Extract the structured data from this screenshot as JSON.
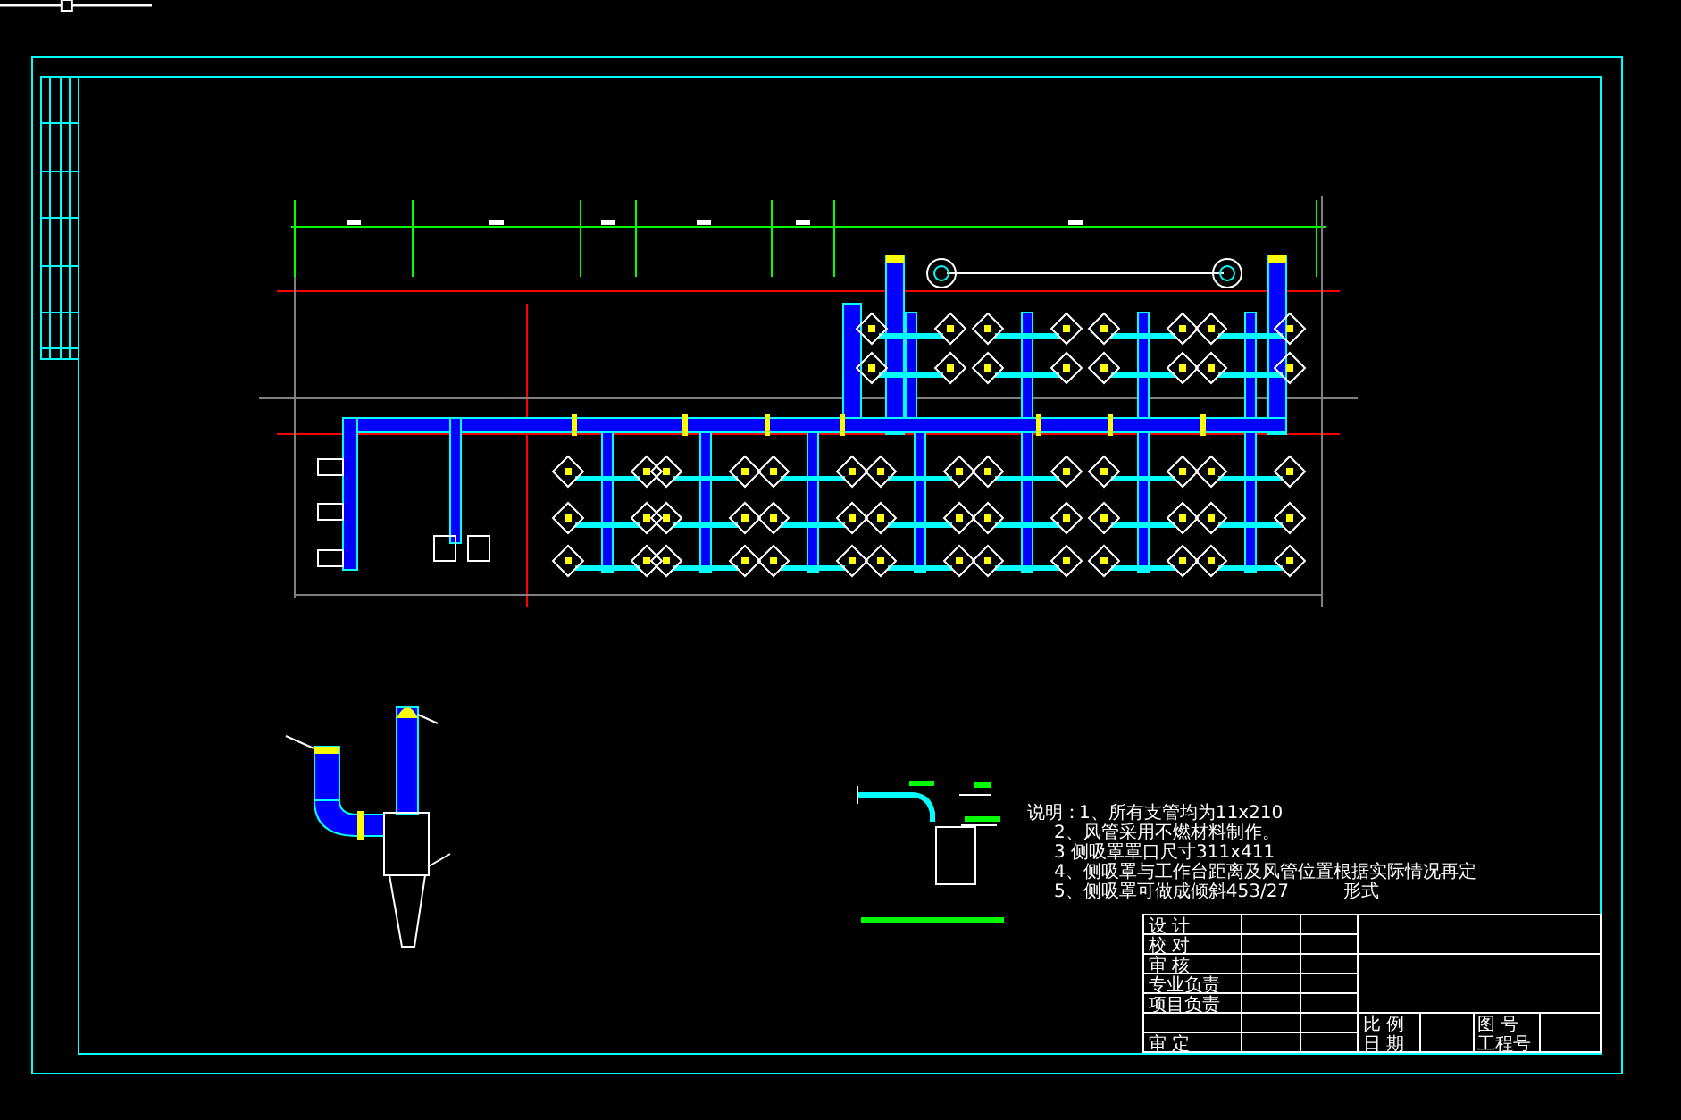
{
  "notes": {
    "heading": "说明：",
    "items": [
      "1、所有支管均为11x210",
      "2、风管采用不燃材料制作。",
      "3  侧吸罩罩口尺寸311x411",
      "4、侧吸罩与工作台距离及风管位置根据实际情况再定",
      "5、侧吸罩可做成倾斜453/27",
      "形式"
    ]
  },
  "zoom_slider": {
    "level": 0.44
  },
  "title_block": {
    "left_labels": [
      "设 计",
      "校 对",
      "审 核",
      "专业负责",
      "项目负责",
      "审 定"
    ],
    "bottom_labels": [
      "比 例",
      "日 期"
    ],
    "right_labels": [
      "图 号",
      "工程号"
    ]
  }
}
